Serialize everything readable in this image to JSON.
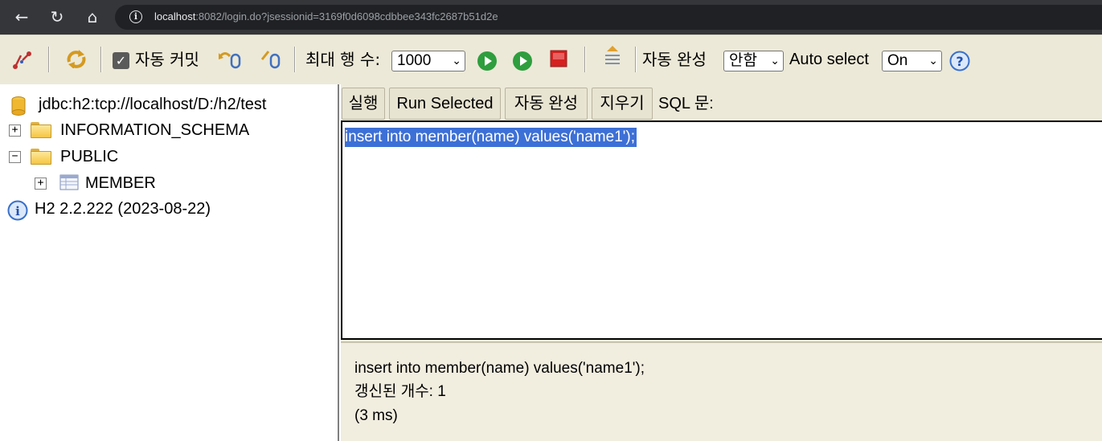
{
  "browser": {
    "url_host": "localhost",
    "url_rest": ":8082/login.do?jsessionid=3169f0d6098cdbbee343fc2687b51d2e"
  },
  "toolbar": {
    "auto_commit_label": "자동 커밋",
    "max_rows_label": "최대 행 수:",
    "max_rows_value": "1000",
    "auto_complete_label": "자동 완성",
    "auto_complete_value": "안함",
    "auto_select_label": "Auto select",
    "auto_select_value": "On",
    "auto_commit_checked": true
  },
  "tree": {
    "connection": "jdbc:h2:tcp://localhost/D:/h2/test",
    "schema_info": "INFORMATION_SCHEMA",
    "schema_public": "PUBLIC",
    "table_member": "MEMBER",
    "version": "H2 2.2.222 (2023-08-22)"
  },
  "sql_toolbar": {
    "run": "실행",
    "run_selected": "Run Selected",
    "auto_complete": "자동 완성",
    "clear": "지우기",
    "sql_label": "SQL 문:"
  },
  "editor": {
    "text": "insert into member(name) values('name1');"
  },
  "result": {
    "statement": "insert into member(name) values('name1');",
    "update_count": "갱신된 개수: 1",
    "time": "(3 ms)"
  },
  "colors": {
    "toolbar_bg": "#ece9d8",
    "selection": "#3d70d6",
    "run_green": "#2e9e3e",
    "stop_red": "#d42020"
  }
}
